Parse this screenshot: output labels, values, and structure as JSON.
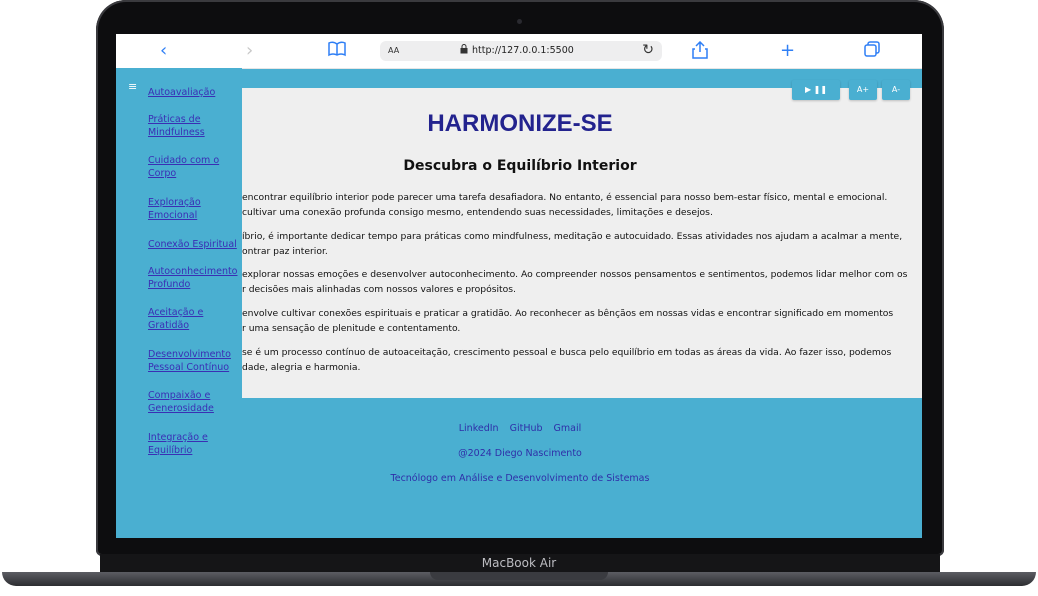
{
  "device": {
    "brand": "MacBook Air"
  },
  "browser": {
    "address_aa": "AA",
    "url": "http://127.0.0.1:5500",
    "icons": [
      "back-icon",
      "forward-icon",
      "book-icon",
      "lock-icon",
      "reload-icon",
      "share-icon",
      "plus-icon",
      "tabs-icon"
    ]
  },
  "controls": {
    "play_pause": "▶ ❚❚",
    "font_increase": "A+",
    "font_decrease": "A-"
  },
  "menu_icon": "≡",
  "sidebar": {
    "items": [
      {
        "label": "Autoavaliação"
      },
      {
        "label": "Práticas de Mindfulness"
      },
      {
        "label": "Cuidado com o Corpo"
      },
      {
        "label": "Exploração Emocional"
      },
      {
        "label": "Conexão Espiritual"
      },
      {
        "label": "Autoconhecimento Profundo"
      },
      {
        "label": "Aceitação e Gratidão"
      },
      {
        "label": "Desenvolvimento Pessoal Contínuo"
      },
      {
        "label": "Compaixão e Generosidade"
      },
      {
        "label": "Integração e Equilíbrio"
      }
    ]
  },
  "main": {
    "title": "HARMONIZE-SE",
    "subtitle": "Descubra o Equilíbrio Interior",
    "paragraphs": [
      [
        "encontrar equilíbrio interior pode parecer uma tarefa desafiadora. No entanto, é essencial para nosso bem-estar físico, mental e emocional.",
        "cultivar uma conexão profunda consigo mesmo, entendendo suas necessidades, limitações e desejos."
      ],
      [
        "íbrio, é importante dedicar tempo para práticas como mindfulness, meditação e autocuidado. Essas atividades nos ajudam a acalmar a mente,",
        "ontrar paz interior."
      ],
      [
        "explorar nossas emoções e desenvolver autoconhecimento. Ao compreender nossos pensamentos e sentimentos, podemos lidar melhor com os",
        "r decisões mais alinhadas com nossos valores e propósitos."
      ],
      [
        "envolve cultivar conexões espirituais e praticar a gratidão. Ao reconhecer as bênçãos em nossas vidas e encontrar significado em momentos",
        "r uma sensação de plenitude e contentamento."
      ],
      [
        "se é um processo contínuo de autoaceitação, crescimento pessoal e busca pelo equilíbrio em todas as áreas da vida. Ao fazer isso, podemos",
        "dade, alegria e harmonia."
      ]
    ]
  },
  "footer": {
    "links": [
      "LinkedIn",
      "GitHub",
      "Gmail"
    ],
    "copyright": "@2024 Diego Nascimento",
    "role": "Tecnólogo em Análise e Desenvolvimento de Sistemas"
  }
}
